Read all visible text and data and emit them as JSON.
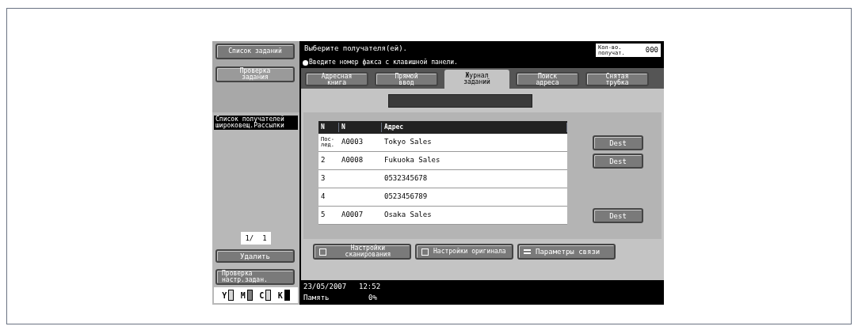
{
  "sidebar": {
    "buttons": [
      {
        "label": "Список заданий"
      },
      {
        "label": "Проверка задания"
      }
    ],
    "list_label": "Список получателей широковещ.Рассылки",
    "page": "1/  1",
    "delete_button": "Удалить",
    "check_button": "Проверка настр.задан.",
    "toner": [
      {
        "label": "Y",
        "color": "#d8d8d8"
      },
      {
        "label": "M",
        "color": "#808080"
      },
      {
        "label": "C",
        "color": "#d8d8d8"
      },
      {
        "label": "K",
        "color": "#000000"
      }
    ]
  },
  "header": {
    "prompt": "Выберите получателя(ей).",
    "hint": "Введите номер факса с клавишной панели.",
    "count_label": "Кол-во. получат.",
    "count": "000"
  },
  "tabs": [
    {
      "label": "Адресная книга",
      "selected": false
    },
    {
      "label": "Прямой ввод",
      "selected": false
    },
    {
      "label": "Журнал заданий",
      "selected": true
    },
    {
      "label": "Поиск адреса",
      "selected": false
    },
    {
      "label": "Снятая трубка",
      "selected": false
    }
  ],
  "table": {
    "columns": [
      "N",
      "N",
      "Адрес"
    ],
    "rows": [
      {
        "cells": [
          "Пос-лед.",
          "A0003",
          "Tokyo Sales"
        ],
        "dest": "Dest"
      },
      {
        "cells": [
          "2",
          "A0008",
          "Fukuoka Sales"
        ],
        "dest": "Dest"
      },
      {
        "cells": [
          "3",
          "",
          "0532345678"
        ]
      },
      {
        "cells": [
          "4",
          "",
          "0523456789"
        ]
      },
      {
        "cells": [
          "5",
          "A0007",
          "Osaka Sales"
        ],
        "dest": "Dest"
      }
    ]
  },
  "bottom_buttons": [
    {
      "kind": "scan",
      "label": "Настройки сканирования"
    },
    {
      "kind": "original",
      "label": "Настройки оригинала"
    },
    {
      "kind": "comm",
      "label": "Параметры связи"
    }
  ],
  "status_bar": {
    "date": "23/05/2007",
    "time": "12:52",
    "memory_label": "Память",
    "memory": "0%"
  }
}
